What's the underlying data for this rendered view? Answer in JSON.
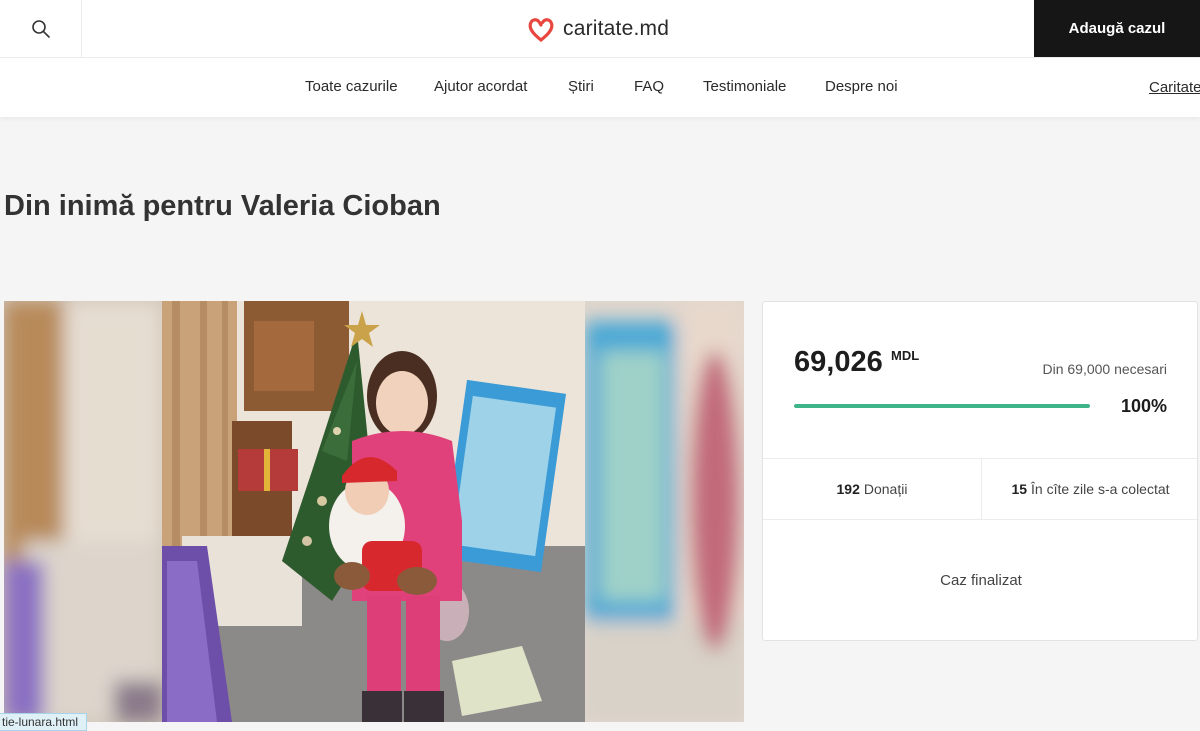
{
  "header": {
    "logo_text": "caritate.md",
    "add_case_label": "Adaugă cazul",
    "search_icon": "search-icon",
    "brand_color": "#e8473f"
  },
  "nav": {
    "items": [
      "Toate cazurile",
      "Ajutor acordat",
      "Știri",
      "FAQ",
      "Testimoniale",
      "Despre noi"
    ],
    "extra": "Caritate"
  },
  "page": {
    "title": "Din inimă pentru Valeria Cioban"
  },
  "stats": {
    "amount": "69,026",
    "currency": "MDL",
    "needed": "Din 69,000 necesari",
    "progress_percent": 100,
    "percent_label": "100%",
    "donations_count": "192",
    "donations_label": "Donații",
    "days_count": "15",
    "days_label": "În cîte zile s-a colectat",
    "status": "Caz finalizat",
    "accent_color": "#3eb489"
  },
  "statusbar": {
    "url": "tie-lunara.html"
  }
}
